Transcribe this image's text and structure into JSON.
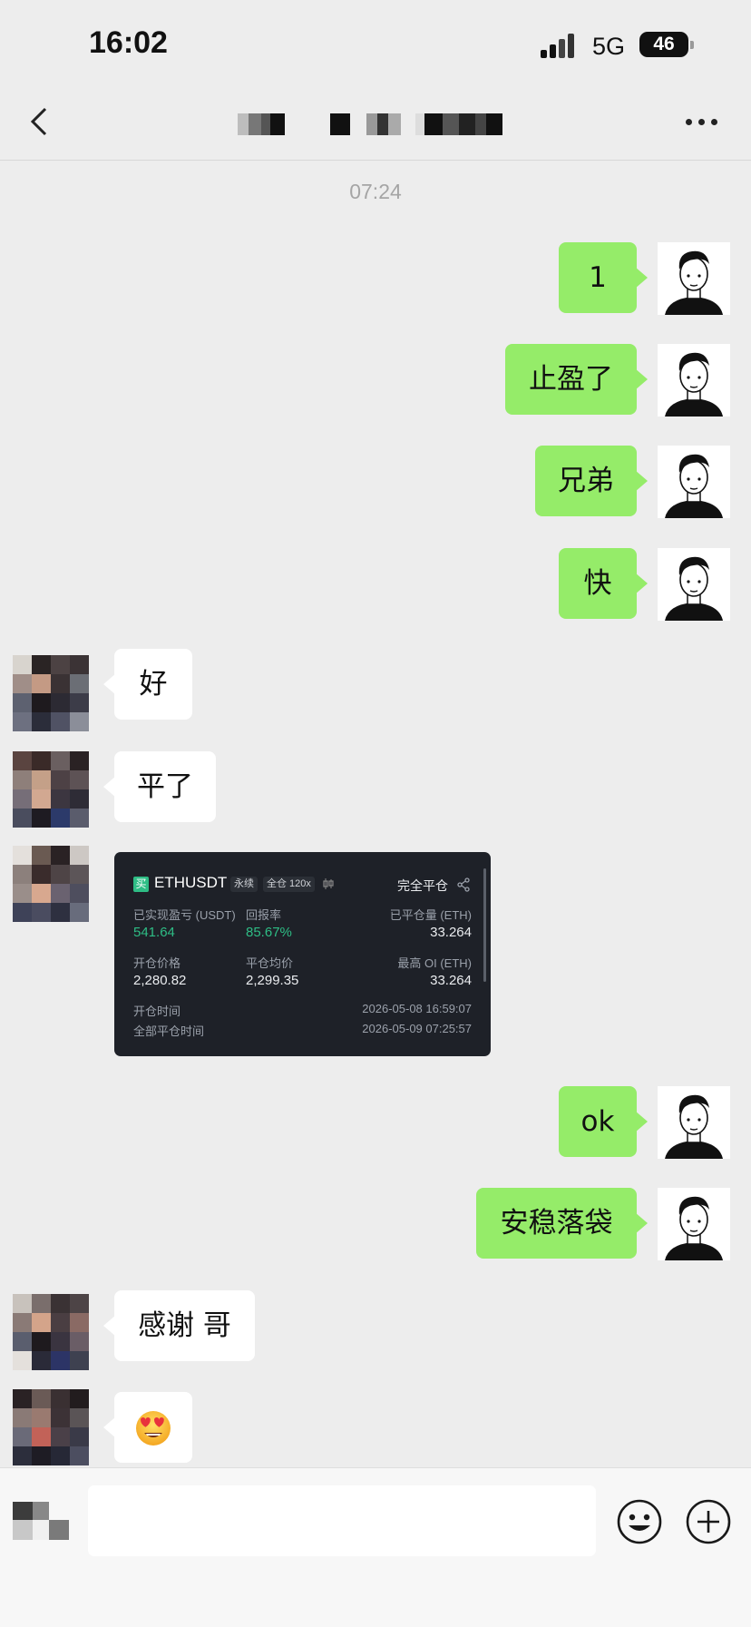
{
  "status_bar": {
    "time": "16:02",
    "network": "5G",
    "battery": "46"
  },
  "nav": {
    "back_icon": "chevron-left-icon",
    "more_icon": "more-icon"
  },
  "timestamp": "07:24",
  "messages": [
    {
      "side": "right",
      "text": "1"
    },
    {
      "side": "right",
      "text": "止盈了"
    },
    {
      "side": "right",
      "text": "兄弟"
    },
    {
      "side": "right",
      "text": "快"
    },
    {
      "side": "left",
      "text": "好"
    },
    {
      "side": "left",
      "text": "平了"
    },
    {
      "side": "left",
      "type": "card"
    },
    {
      "side": "right",
      "text": "ok"
    },
    {
      "side": "right",
      "text": "安稳落袋"
    },
    {
      "side": "left",
      "text": "感谢 哥"
    },
    {
      "side": "left",
      "type": "emoji",
      "icon": "heart-eyes-emoji-icon"
    }
  ],
  "card": {
    "icon_text": "买",
    "symbol": "ETHUSDT",
    "tag_perp": "永续",
    "tag_margin": "全仓 120x",
    "status": "完全平仓",
    "realized_pnl_label": "已实现盈亏 (USDT)",
    "realized_pnl": "541.64",
    "roi_label": "回报率",
    "roi": "85.67%",
    "closed_qty_label": "已平仓量 (ETH)",
    "closed_qty": "33.264",
    "open_price_label": "开仓价格",
    "open_price": "2,280.82",
    "close_avg_label": "平仓均价",
    "close_avg": "2,299.35",
    "max_oi_label": "最高 OI (ETH)",
    "max_oi": "33.264",
    "open_time_label": "开仓时间",
    "open_time": "2026-05-08 16:59:07",
    "close_time_label": "全部平仓时间",
    "close_time": "2026-05-09 07:25:57"
  },
  "colors": {
    "bubble_self": "#95ec69",
    "bubble_other": "#ffffff",
    "background": "#ededed",
    "profit": "#2ebd85"
  }
}
